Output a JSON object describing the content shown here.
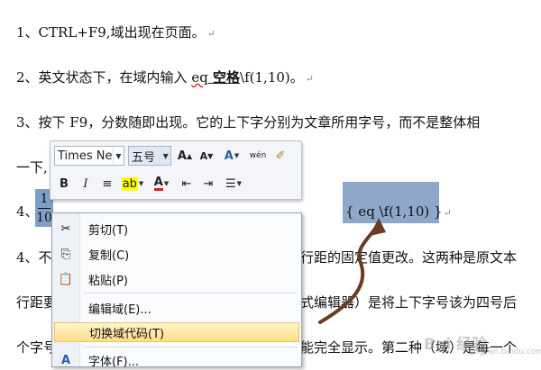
{
  "doc": {
    "line1": "1、CTRL+F9,域出现在页面。",
    "line2_a": "2、英文状态下，在域内输入 ",
    "line2_eq": "eq",
    "line2_space": " 空格",
    "line2_b": "\\f(1,10)。",
    "line3": "3、按下 F9，分数随即出现。它的上下字分别为文章所用字号，而不是整体相",
    "line3b": "一下,",
    "line4_prefix": "4、",
    "frac_num": "1",
    "frac_den": "10",
    "line5_a": "4、不",
    "line5_b": "行距的固定值更改。这两种是原文本",
    "line6_a": "行距要",
    "line6_b": "式编辑器）是将上下字号该为四号后",
    "line7_a": "个字号",
    "line7_b": "能完全显示。第二种（域）是每一个",
    "field_code": "{ eq \\f(1,10) }",
    "para_mark": "↵"
  },
  "mini_toolbar": {
    "font": "Times Ne",
    "size": "五号",
    "grow": "A",
    "shrink": "A",
    "style": "A",
    "phonetic": "wén"
  },
  "context_menu": {
    "items": [
      {
        "label": "剪切(T)",
        "icon": "scissors-icon"
      },
      {
        "label": "复制(C)",
        "icon": "copy-icon"
      },
      {
        "label": "粘贴(P)",
        "icon": "paste-icon"
      },
      {
        "label": "编辑域(E)...",
        "icon": ""
      },
      {
        "label": "切换域代码(T)",
        "icon": ""
      },
      {
        "label": "字体(F)...",
        "icon": "font-icon"
      }
    ]
  },
  "watermark": "Bai 经验",
  "watermark_sub": "jingyan.baidu.com"
}
